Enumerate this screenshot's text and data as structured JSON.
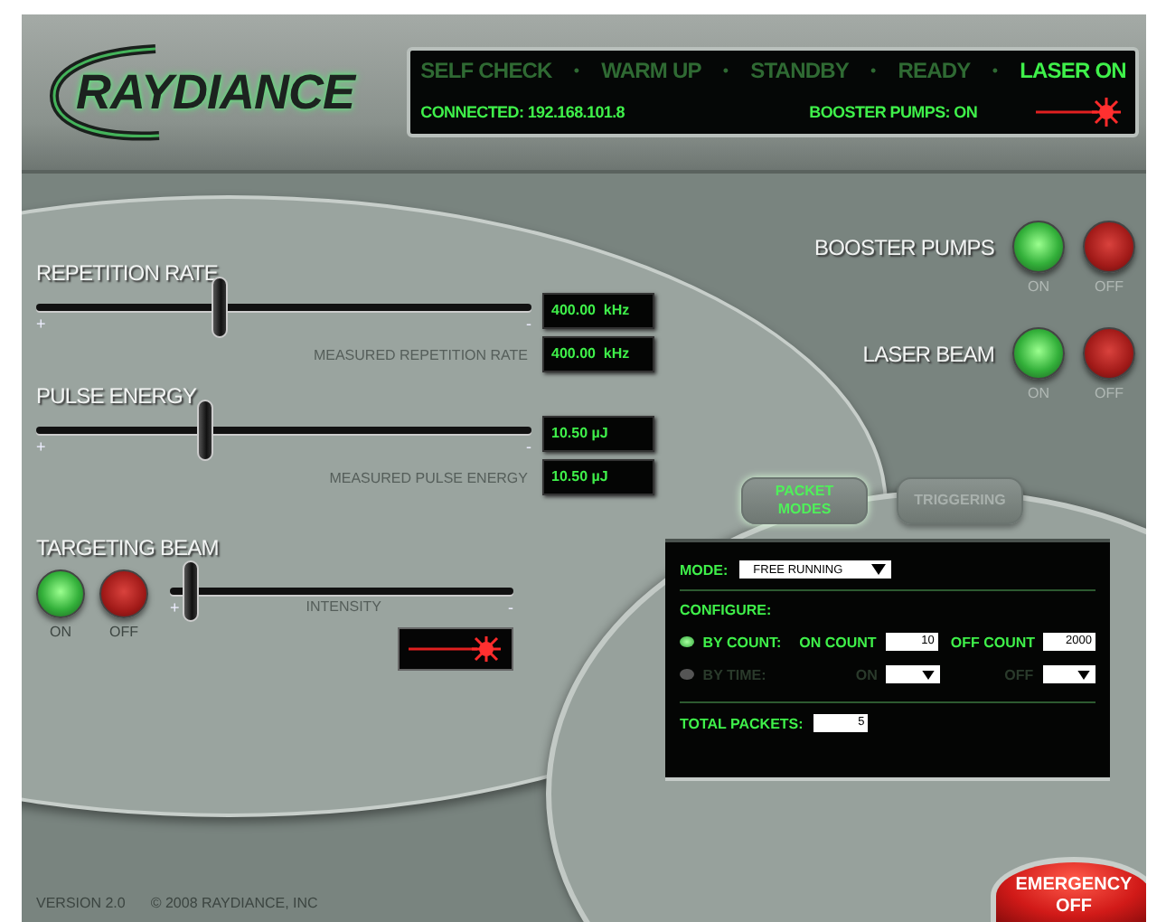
{
  "logo": {
    "text": "RAYDIANCE"
  },
  "status": {
    "stages": [
      {
        "label": "SELF CHECK",
        "selected": false
      },
      {
        "label": "WARM UP",
        "selected": false
      },
      {
        "label": "STANDBY",
        "selected": false
      },
      {
        "label": "READY",
        "selected": false
      },
      {
        "label": "LASER ON",
        "selected": true
      }
    ],
    "separators": [
      "•",
      "•",
      "•",
      "•"
    ],
    "connection": "CONNECTED: 192.168.101.8",
    "booster_pumps": "BOOSTER PUMPS: ON",
    "laser_on": true
  },
  "controls": [
    {
      "label": "REPETITION RATE",
      "level": 0.37,
      "min_mark": "+",
      "max_mark": "-",
      "setpoint": "400.00  kHz",
      "measured_label": "MEASURED REPETITION RATE",
      "measured": "400.00  kHz"
    },
    {
      "label": "PULSE ENERGY",
      "level": 0.34,
      "min_mark": "+",
      "max_mark": "-",
      "setpoint": "10.50 µJ",
      "measured_label": "MEASURED PULSE ENERGY",
      "measured": "10.50 µJ"
    }
  ],
  "switches": [
    {
      "label": "BOOSTER PUMPS",
      "on_label": "ON",
      "off_label": "OFF"
    },
    {
      "label": "LASER BEAM",
      "on_label": "ON",
      "off_label": "OFF"
    }
  ],
  "targeting": {
    "label": "TARGETING BEAM",
    "on_label": "ON",
    "off_label": "OFF",
    "intensity_label": "INTENSITY",
    "level": 0.06,
    "min_mark": "+",
    "max_mark": "-",
    "beam_on": true
  },
  "packet": {
    "tabs": [
      {
        "label": "PACKET\nMODES",
        "selected": true
      },
      {
        "label": "TRIGGERING",
        "selected": false
      }
    ],
    "mode_label": "MODE:",
    "mode": "FREE RUNNING",
    "configure_label": "CONFIGURE:",
    "options": [
      {
        "kind": "input",
        "label": "BY COUNT:",
        "selected": true,
        "on_label": "ON COUNT",
        "on_value": "10",
        "off_label": "OFF COUNT",
        "off_value": "2000"
      },
      {
        "kind": "dropdown",
        "label": "BY TIME:",
        "selected": false,
        "on_label": "ON",
        "off_label": "OFF"
      }
    ],
    "total_label": "TOTAL PACKETS:",
    "total": "5"
  },
  "footer": {
    "version": "VERSION 2.0",
    "copyright": "© 2008 RAYDIANCE, INC"
  },
  "emergency": "EMERGENCY\nOFF"
}
